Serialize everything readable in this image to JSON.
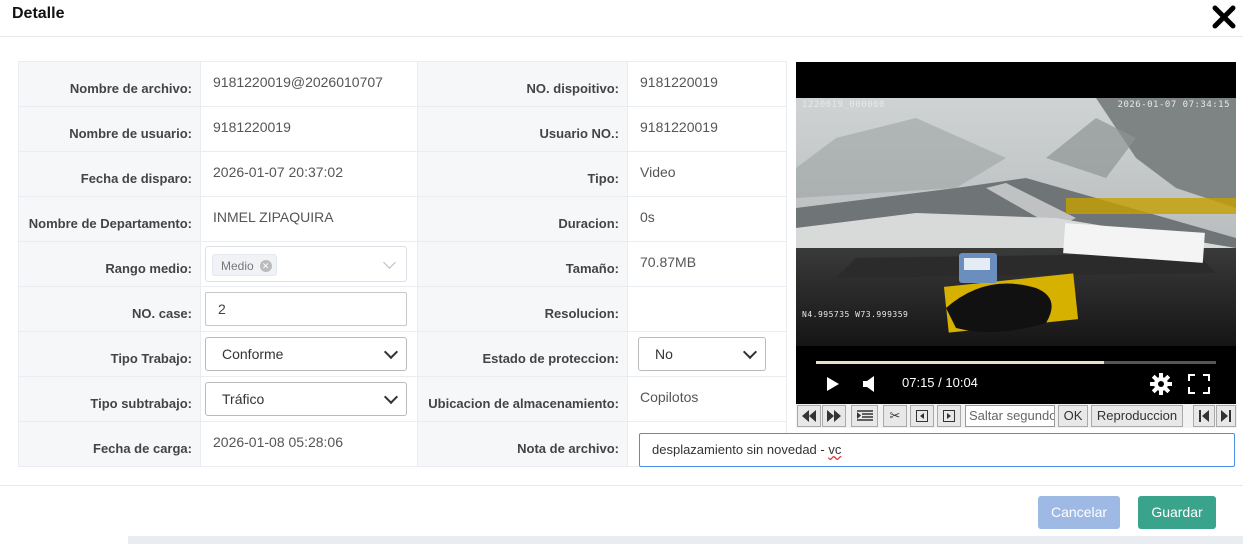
{
  "header": {
    "title": "Detalle"
  },
  "rows": [
    {
      "l1": "Nombre de archivo:",
      "v1": "9181220019@2026010707",
      "l2": "NO. dispoitivo:",
      "v2": "9181220019"
    },
    {
      "l1": "Nombre de usuario:",
      "v1": "9181220019",
      "l2": "Usuario NO.:",
      "v2": "9181220019"
    },
    {
      "l1": "Fecha de disparo:",
      "v1": "2026-01-07 20:37:02",
      "l2": "Tipo:",
      "v2": "Video"
    },
    {
      "l1": "Nombre de Departamento:",
      "v1": "INMEL ZIPAQUIRA",
      "l2": "Duracion:",
      "v2": "0s"
    },
    {
      "l1": "Rango medio:",
      "v1": "Medio",
      "l2": "Tamaño:",
      "v2": "70.87MB"
    },
    {
      "l1": "NO. case:",
      "v1": "2",
      "l2": "Resolucion:",
      "v2": ""
    },
    {
      "l1": "Tipo Trabajo:",
      "v1": "Conforme",
      "l2": "Estado de proteccion:",
      "v2": "No"
    },
    {
      "l1": "Tipo subtrabajo:",
      "v1": "Tráfico",
      "l2": "Ubicacion de almacenamiento:",
      "v2": "Copilotos"
    },
    {
      "l1": "Fecha de carga:",
      "v1": "2026-01-08 05:28:06",
      "l2": "Nota de archivo:"
    }
  ],
  "note": {
    "text": "desplazamiento sin novedad - ",
    "misspelled": "vc"
  },
  "video": {
    "osd_top_left": "1220019_000000",
    "osd_top_right": "2026-01-07 07:34:15",
    "osd_gps": "N4.995735 W73.999359",
    "time": "07:15 / 10:04",
    "progress": 0.72
  },
  "controls": {
    "seek_placeholder": "Saltar segundos",
    "ok": "OK",
    "playback": "Reproduccion"
  },
  "footer": {
    "cancel": "Cancelar",
    "save": "Guardar"
  },
  "colors": {
    "save": "#39a48b",
    "cancel": "#9eb9e4",
    "focus": "#4a90e2"
  }
}
